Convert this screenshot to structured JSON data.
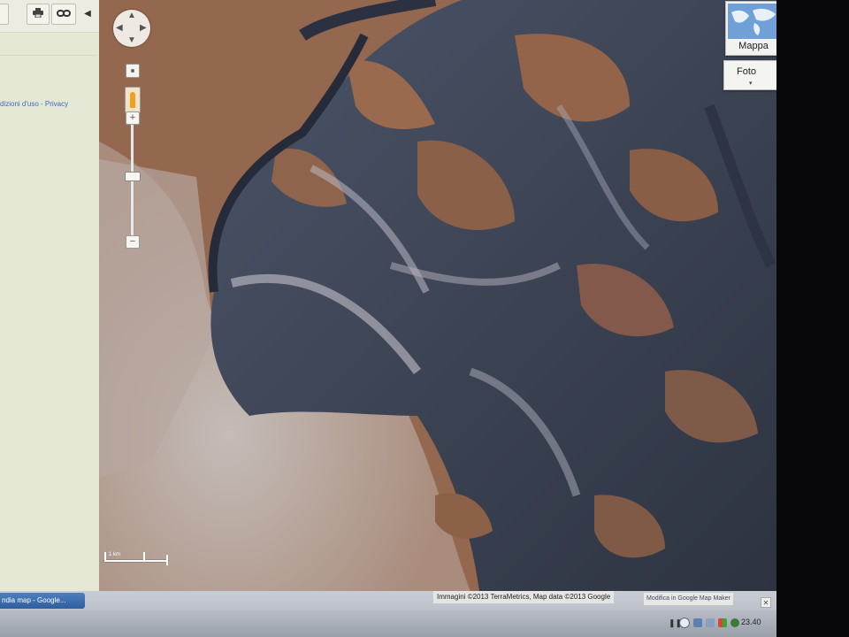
{
  "left_panel": {
    "toolbar": {
      "print_icon": "printer-icon",
      "link_icon": "link-icon",
      "collapse_icon": "chevron-left-icon"
    },
    "terms_text": "dizioni d'uso - Privacy"
  },
  "map_controls": {
    "pan_icon": "pan-control-icon",
    "pegman_icon": "pegman-icon",
    "zoom_in": "+",
    "zoom_out": "−",
    "zoom_level_fraction": 0.45
  },
  "map_type": {
    "map_label": "Mappa",
    "photo_label": "Foto",
    "photo_caret": "▾"
  },
  "scale_bar": {
    "label": "1 km"
  },
  "attribution": "Immagini ©2013 TerraMetrics, Map data ©2013 Google",
  "report_link": "Modifica in Google Map Maker",
  "taskbar": {
    "active_window": "ndia map - Google...",
    "clock": "23.40"
  },
  "colors": {
    "plateau": "#a36a4e",
    "canyon_shadow": "#3a4658",
    "canyon_light": "#b9b7c2",
    "valley_floor": "#bdb4ae",
    "panel_bg": "#e6e8d6"
  }
}
